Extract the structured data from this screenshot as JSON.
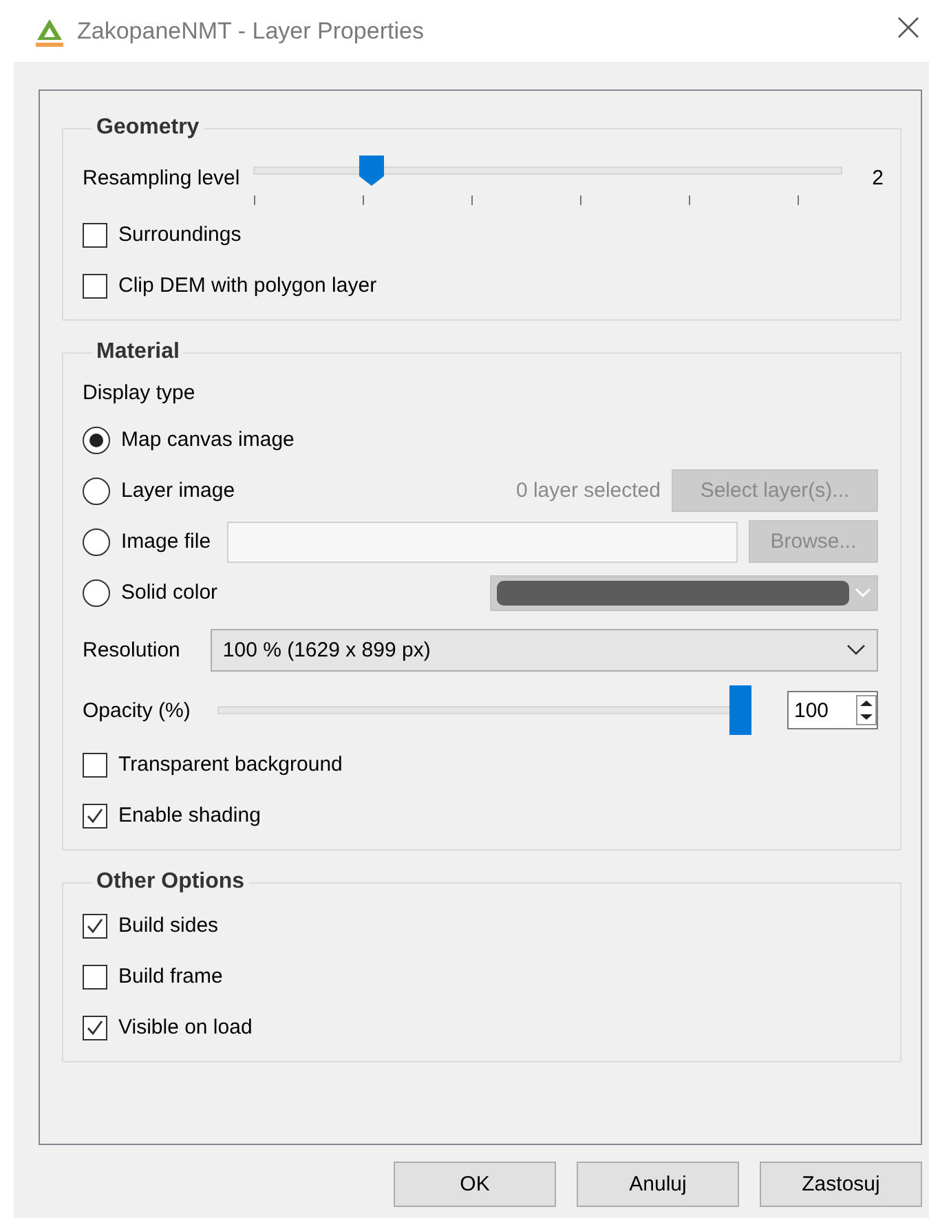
{
  "window": {
    "title": "ZakopaneNMT - Layer Properties"
  },
  "geometry": {
    "title": "Geometry",
    "resampling": {
      "label": "Resampling level",
      "level": 0.2,
      "value": "2"
    },
    "checkboxes": [
      {
        "label": "Surroundings",
        "checked": false
      },
      {
        "label": "Clip DEM with polygon layer",
        "checked": false
      }
    ]
  },
  "material": {
    "title": "Material",
    "display_type_label": "Display type",
    "options": [
      {
        "kind": "plain",
        "label": "Map canvas image",
        "selected": true
      },
      {
        "kind": "layer",
        "label": "Layer image",
        "selected": false,
        "status": "0 layer selected",
        "button": {
          "label": "Select layer(s)...",
          "disabled": true
        }
      },
      {
        "kind": "file",
        "label": "Image file",
        "selected": false,
        "button": {
          "label": "Browse...",
          "disabled": true
        }
      },
      {
        "kind": "color",
        "label": "Solid color",
        "selected": false,
        "color": "#5c5c5c"
      }
    ],
    "resolution": {
      "label": "Resolution",
      "value": "100 %  (1629 x 899 px)"
    },
    "opacity": {
      "label": "Opacity (%)",
      "level": 1,
      "value": "100"
    },
    "checkboxes": [
      {
        "label": "Transparent background",
        "checked": false
      },
      {
        "label": "Enable shading",
        "checked": true
      }
    ]
  },
  "other_options": {
    "title": "Other Options",
    "checkboxes": [
      {
        "label": "Build sides",
        "checked": true
      },
      {
        "label": "Build frame",
        "checked": false
      },
      {
        "label": "Visible on load",
        "checked": true
      }
    ]
  },
  "buttons": [
    {
      "label": "OK"
    },
    {
      "label": "Anuluj"
    },
    {
      "label": "Zastosuj"
    }
  ]
}
